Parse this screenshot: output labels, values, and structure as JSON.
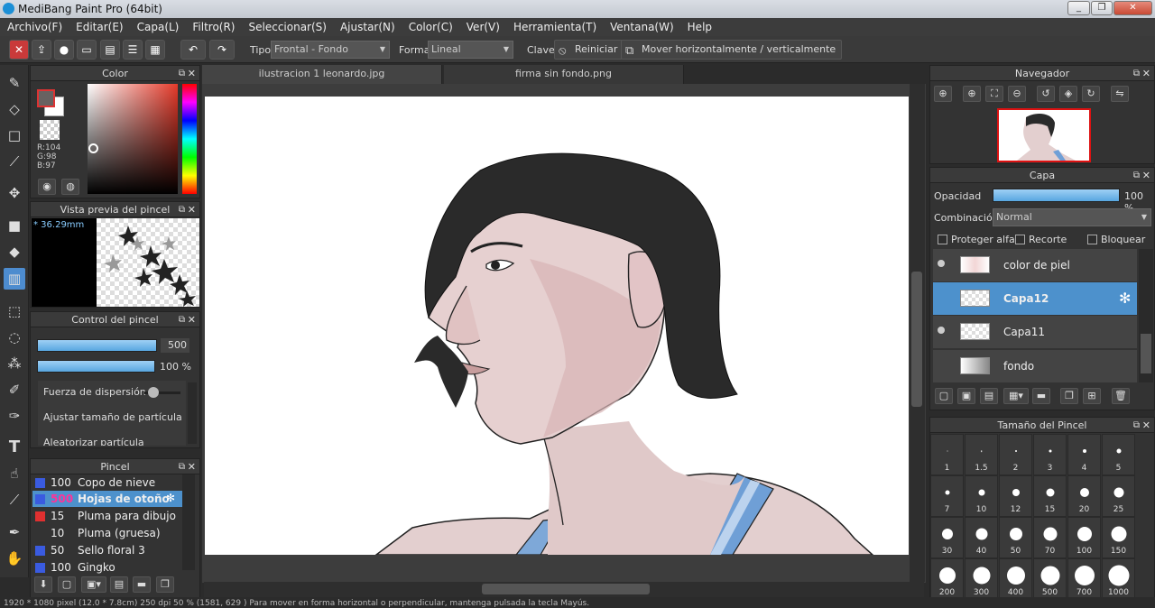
{
  "app": {
    "title": "MediBang Paint Pro (64bit)"
  },
  "menu": [
    "Archivo(F)",
    "Editar(E)",
    "Capa(L)",
    "Filtro(R)",
    "Seleccionar(S)",
    "Ajustar(N)",
    "Color(C)",
    "Ver(V)",
    "Herramienta(T)",
    "Ventana(W)",
    "Help"
  ],
  "toolbar": {
    "tipo_label": "Tipo",
    "tipo_value": "Frontal - Fondo",
    "forma_label": "Forma",
    "forma_value": "Lineal",
    "clave_label": "Clave",
    "reiniciar_label": "Reiniciar",
    "mover_label": "Mover horizontalmente / verticalmente"
  },
  "tabs": [
    "ilustracion 1 leonardo.jpg",
    "firma sin fondo.png"
  ],
  "color_panel": {
    "title": "Color",
    "r": "R:104",
    "g": "G:98",
    "b": "B:97"
  },
  "brush_preview": {
    "title": "Vista previa del pincel",
    "size": "* 36.29mm"
  },
  "brush_control": {
    "title": "Control del pincel",
    "size_value": "500",
    "opacity_value": "100 %",
    "options": [
      "Fuerza de dispersión",
      "Ajustar tamaño de partícula",
      "Aleatorizar partícula"
    ]
  },
  "brush_panel": {
    "title": "Pincel",
    "items": [
      {
        "value": "100",
        "name": "Copo de nieve",
        "color": "#3a5be0"
      },
      {
        "value": "500",
        "name": "Hojas de otoño",
        "color": "#3a5be0"
      },
      {
        "value": "15",
        "name": "Pluma para dibujo",
        "color": "#e03030"
      },
      {
        "value": "10",
        "name": "Pluma (gruesa)",
        "color": "#333333"
      },
      {
        "value": "50",
        "name": "Sello floral 3",
        "color": "#3a5be0"
      },
      {
        "value": "100",
        "name": "Gingko",
        "color": "#3a5be0"
      }
    ]
  },
  "navigator": {
    "title": "Navegador"
  },
  "layer_panel": {
    "title": "Capa",
    "opacity_label": "Opacidad",
    "opacity_value": "100 %",
    "blend_label": "Combinación",
    "blend_value": "Normal",
    "protect_alpha": "Proteger alfa",
    "clip": "Recorte",
    "lock": "Bloquear",
    "layers": [
      "color de piel",
      "Capa12",
      "Capa11",
      "fondo"
    ]
  },
  "brush_size": {
    "title": "Tamaño del Pincel",
    "sizes": [
      "1",
      "1.5",
      "2",
      "3",
      "4",
      "5",
      "7",
      "10",
      "12",
      "15",
      "20",
      "25",
      "30",
      "40",
      "50",
      "70",
      "100",
      "150",
      "200",
      "300",
      "400",
      "500",
      "700",
      "1000"
    ]
  },
  "status": {
    "text": "1920 * 1080 pixel   (12.0 * 7.8cm)   250 dpi   50 %   (1581, 629 )   Para mover en forma horizontal o perpendicular, mantenga pulsada la tecla Mayús."
  },
  "colors": {
    "accent": "#4d91cc",
    "primary_color": "#686261"
  }
}
